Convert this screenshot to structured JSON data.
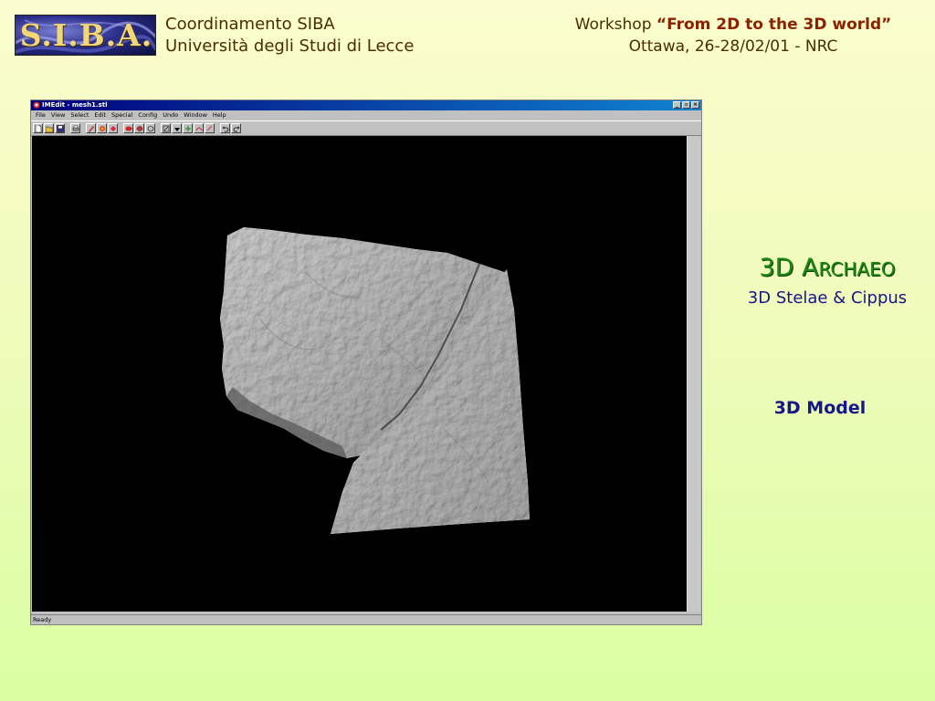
{
  "header": {
    "logo_text": "S.I.B.A.",
    "org_line1": "Coordinamento SIBA",
    "org_line2": "Università degli Studi di Lecce",
    "workshop_prefix": "Workshop ",
    "workshop_title": "“From 2D to the 3D world”",
    "workshop_line2": "Ottawa, 26-28/02/01 - NRC"
  },
  "app": {
    "title": "IMEdit - mesh1.stl",
    "menu": [
      "File",
      "View",
      "Select",
      "Edit",
      "Special",
      "Config",
      "Undo",
      "Window",
      "Help"
    ],
    "window_controls": {
      "minimize": "_",
      "maximize": "▫",
      "close": "×"
    },
    "toolbar_icons": [
      "new-icon",
      "open-icon",
      "save-icon",
      "print-icon",
      "pen-icon",
      "rotate-icon",
      "color-icon",
      "mesh-icon",
      "fill-icon",
      "deselect-icon",
      "move-icon",
      "lower-icon",
      "flip-icon",
      "paint-icon",
      "undo-icon",
      "redo-icon"
    ],
    "status_text": "Ready"
  },
  "panel": {
    "title_3d": "3D ",
    "title_first": "A",
    "title_rest": "RCHAEO",
    "subtitle": "3D Stelae & Cippus",
    "model_label": "3D Model"
  },
  "colors": {
    "page_top": "#fbfdce",
    "page_bottom": "#dafea2",
    "title_green": "#1d8a12",
    "subtitle_blue": "#16168a",
    "header_brown": "#4a2d00",
    "workshop_red": "#8a2200"
  }
}
